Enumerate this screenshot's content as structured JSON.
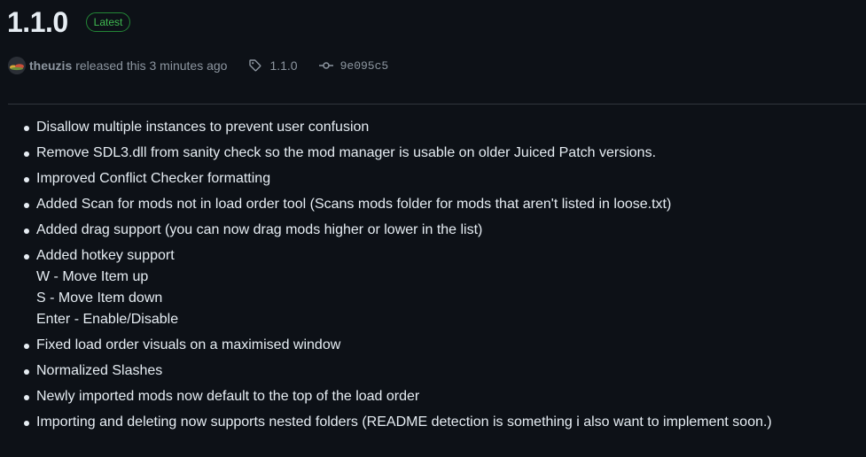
{
  "release": {
    "title": "1.1.0",
    "badge": "Latest",
    "author": "theuzis",
    "released_text": "released this 3 minutes ago",
    "tag": "1.1.0",
    "commit": "9e095c5"
  },
  "notes": [
    "Disallow multiple instances to prevent user confusion",
    "Remove SDL3.dll from sanity check so the mod manager is usable on older Juiced Patch versions.",
    "Improved Conflict Checker formatting",
    "Added Scan for mods not in load order tool (Scans mods folder for mods that aren't listed in loose.txt)",
    "Added drag support (you can now drag mods higher or lower in the list)",
    "Added hotkey support",
    "Fixed load order visuals on a maximised window",
    "Normalized Slashes",
    "Newly imported mods now default to the top of the load order",
    "Importing and deleting now supports nested folders (README detection is something i also want to implement soon.)"
  ],
  "hotkeys": [
    "W - Move Item up",
    "S - Move Item down",
    "Enter - Enable/Disable"
  ],
  "colors": {
    "background": "#0d1117",
    "text": "#e6edf3",
    "muted": "#8d96a0",
    "badge_border": "#238636",
    "badge_text": "#3fb950",
    "divider": "#30363d"
  },
  "icons": {
    "tag": "tag-icon",
    "commit": "git-commit-icon",
    "avatar": "user-avatar"
  }
}
